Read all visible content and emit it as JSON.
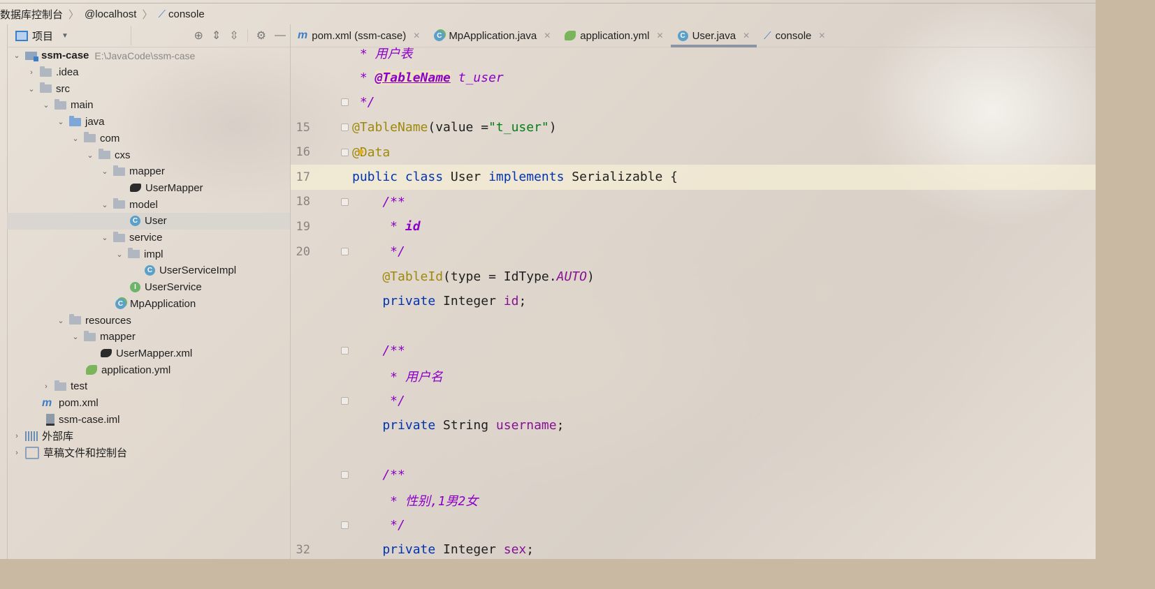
{
  "navbar": {
    "crumbs": [
      "数据库控制台",
      "@localhost",
      "console"
    ]
  },
  "project_panel": {
    "view_label": "项目",
    "tree": [
      {
        "label": "ssm-case",
        "path": "E:\\JavaCode\\ssm-case",
        "icon": "module-folder-icon",
        "expanded": true
      },
      {
        "label": ".idea",
        "icon": "folder-icon",
        "expanded": false
      },
      {
        "label": "src",
        "icon": "folder-icon",
        "expanded": true
      },
      {
        "label": "main",
        "icon": "folder-icon",
        "expanded": true
      },
      {
        "label": "java",
        "icon": "source-folder-icon",
        "expanded": true
      },
      {
        "label": "com",
        "icon": "package-icon",
        "expanded": true
      },
      {
        "label": "cxs",
        "icon": "package-icon",
        "expanded": true
      },
      {
        "label": "mapper",
        "icon": "package-icon",
        "expanded": true
      },
      {
        "label": "UserMapper",
        "icon": "mybatis-mapper-icon"
      },
      {
        "label": "model",
        "icon": "package-icon",
        "expanded": true
      },
      {
        "label": "User",
        "icon": "class-icon",
        "selected": true
      },
      {
        "label": "service",
        "icon": "package-icon",
        "expanded": true
      },
      {
        "label": "impl",
        "icon": "package-icon",
        "expanded": true
      },
      {
        "label": "UserServiceImpl",
        "icon": "class-icon"
      },
      {
        "label": "UserService",
        "icon": "interface-icon"
      },
      {
        "label": "MpApplication",
        "icon": "spring-boot-class-icon"
      },
      {
        "label": "resources",
        "icon": "resources-folder-icon",
        "expanded": true
      },
      {
        "label": "mapper",
        "icon": "folder-icon",
        "expanded": true
      },
      {
        "label": "UserMapper.xml",
        "icon": "mybatis-xml-icon"
      },
      {
        "label": "application.yml",
        "icon": "yaml-icon"
      },
      {
        "label": "test",
        "icon": "folder-icon",
        "expanded": false
      },
      {
        "label": "pom.xml",
        "icon": "maven-icon"
      },
      {
        "label": "ssm-case.iml",
        "icon": "iml-file-icon"
      },
      {
        "label": "外部库",
        "icon": "library-icon",
        "expanded": false
      },
      {
        "label": "草稿文件和控制台",
        "icon": "scratches-icon",
        "expanded": false
      }
    ]
  },
  "editor": {
    "tabs": [
      {
        "label": "pom.xml (ssm-case)",
        "icon": "maven-icon"
      },
      {
        "label": "MpApplication.java",
        "icon": "spring-boot-class-icon"
      },
      {
        "label": "application.yml",
        "icon": "yaml-icon"
      },
      {
        "label": "User.java",
        "icon": "class-icon",
        "active": true
      },
      {
        "label": "console",
        "icon": "console-icon"
      }
    ],
    "line_numbers": {
      "l15": "15",
      "l16": "16",
      "l17": "17",
      "l18": "18",
      "l19": "19",
      "l20": "20",
      "l32": "32"
    },
    "code": {
      "c1_a": " * ",
      "c1_b": "用户表",
      "c2_a": " * ",
      "c2_b": "@TableName",
      "c2_c": " t_user",
      "c3": " */",
      "c4_a": "@TableName",
      "c4_b": "(value =",
      "c4_c": "\"t_user\"",
      "c4_d": ")",
      "c5_a": "@",
      "c5_b": "Data",
      "c6_a": "public class ",
      "c6_b": "User ",
      "c6_c": "implements ",
      "c6_d": "Serializable {",
      "c7": "    /**",
      "c8_a": "     * ",
      "c8_b": "id",
      "c9": "     */",
      "c10_a": "    @TableId",
      "c10_b": "(type = IdType.",
      "c10_c": "AUTO",
      "c10_d": ")",
      "c11_a": "    private ",
      "c11_b": "Integer ",
      "c11_c": "id",
      "c11_d": ";",
      "c12": "",
      "c13": "    /**",
      "c14_a": "     * ",
      "c14_b": "用户名",
      "c15": "     */",
      "c16_a": "    private ",
      "c16_b": "String ",
      "c16_c": "username",
      "c16_d": ";",
      "c17": "",
      "c18": "    /**",
      "c19_a": "     * ",
      "c19_b": "性别,1男2女",
      "c20": "     */",
      "c21_a": "    private ",
      "c21_b": "Integer ",
      "c21_c": "sex",
      "c21_d": ";"
    }
  },
  "colors": {
    "keyword": "#0033b3",
    "annotation": "#9e880d",
    "string": "#067d17",
    "doc_comment": "#8c00c8",
    "field": "#871094",
    "accent_blue": "#3d7ec9"
  }
}
